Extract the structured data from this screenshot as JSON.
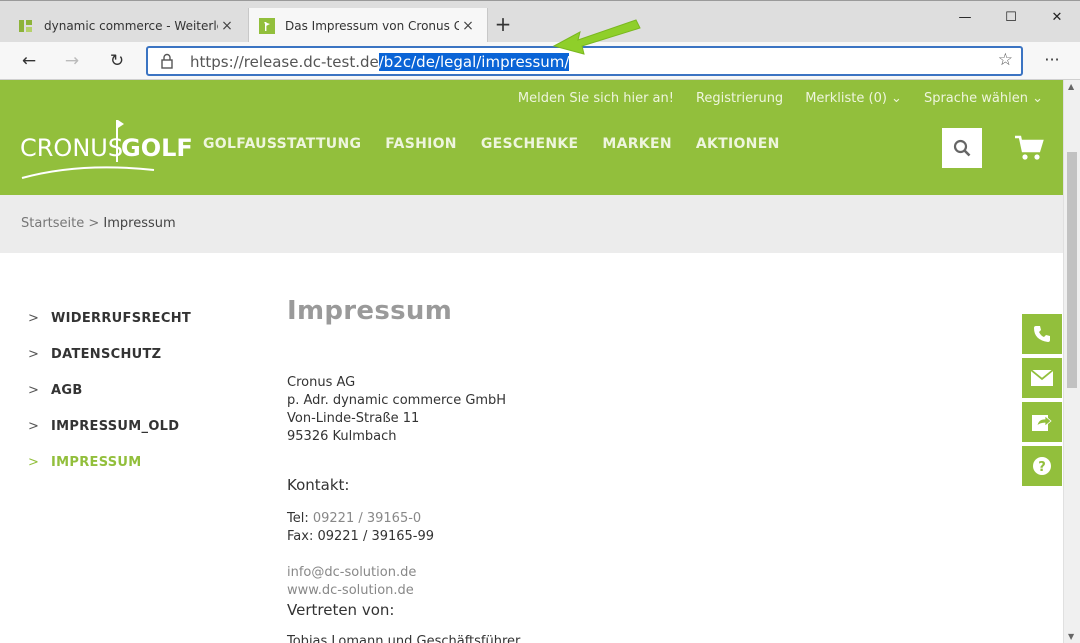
{
  "browser": {
    "tabs": [
      {
        "title": "dynamic commerce - Weiterleitung",
        "active": false
      },
      {
        "title": "Das Impressum von Cronus Golf",
        "active": true
      }
    ],
    "close_glyph": "×",
    "new_tab_glyph": "+",
    "minimize_glyph": "—",
    "maximize_glyph": "☐",
    "window_close_glyph": "✕",
    "back_glyph": "←",
    "forward_glyph": "→",
    "refresh_glyph": "↻",
    "url_plain": "https://release.dc-test.de",
    "url_selected": "/b2c/de/legal/impressum/",
    "star_glyph": "☆",
    "more_glyph": "···"
  },
  "header": {
    "meta_links": [
      "Melden Sie sich hier an!",
      "Registrierung",
      "Merkliste (0) ⌄",
      "Sprache wählen ⌄"
    ],
    "logo_left": "CRONUS",
    "logo_right": "GOLF",
    "nav": [
      "GOLFAUSSTATTUNG",
      "FASHION",
      "GESCHENKE",
      "MARKEN",
      "AKTIONEN"
    ]
  },
  "breadcrumb": {
    "home": "Startseite",
    "separator": " > ",
    "current": "Impressum"
  },
  "sidebar": {
    "chevron": ">",
    "items": [
      {
        "label": "WIDERRUFSRECHT",
        "active": false
      },
      {
        "label": "DATENSCHUTZ",
        "active": false
      },
      {
        "label": "AGB",
        "active": false
      },
      {
        "label": "IMPRESSUM_OLD",
        "active": false
      },
      {
        "label": "IMPRESSUM",
        "active": true
      }
    ]
  },
  "content": {
    "title": "Impressum",
    "address": [
      "Cronus AG",
      "p. Adr. dynamic commerce GmbH",
      "Von-Linde-Straße 11",
      "95326 Kulmbach"
    ],
    "kontakt_label": "Kontakt:",
    "tel_label": "Tel: ",
    "tel_value": "09221 / 39165-0",
    "fax_line": "Fax: 09221 / 39165-99",
    "email": "info@dc-solution.de",
    "website": "www.dc-solution.de",
    "vertreten_label": "Vertreten von:",
    "cutoff_line": "Tobias Lomann und Geschäftsführer"
  },
  "colors": {
    "brand_green": "#92bf3c",
    "selection_blue": "#0a64d6"
  },
  "icons": {
    "float_buttons": [
      "phone-icon",
      "mail-icon",
      "share-icon",
      "help-icon"
    ]
  }
}
